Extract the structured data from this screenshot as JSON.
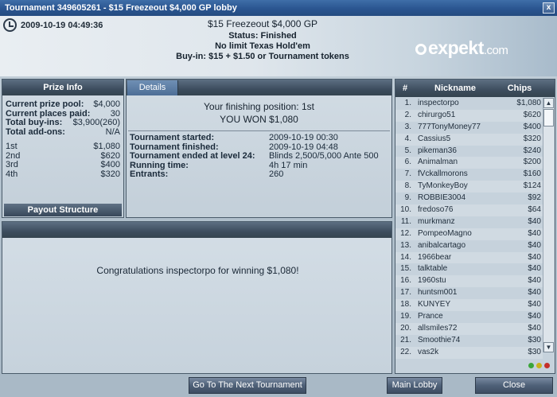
{
  "window": {
    "title": "Tournament 349605261 - $15 Freezeout $4,000 GP lobby",
    "close_label": "x"
  },
  "header": {
    "datetime": "2009-10-19 04:49:36",
    "name": "$15 Freezeout $4,000 GP",
    "status": "Status: Finished",
    "game": "No limit Texas Hold'em",
    "buyin": "Buy-in: $15 + $1.50 or Tournament tokens",
    "logo_text": "expekt",
    "logo_suffix": ".com"
  },
  "prize_info": {
    "title": "Prize Info",
    "rows": [
      {
        "k": "Current prize pool:",
        "v": "$4,000"
      },
      {
        "k": "Current places paid:",
        "v": "30"
      },
      {
        "k": "Total buy-ins:",
        "v": "$3,900(260)"
      },
      {
        "k": "Total add-ons:",
        "v": "N/A"
      }
    ],
    "places": [
      {
        "k": "1st",
        "v": "$1,080"
      },
      {
        "k": "2nd",
        "v": "$620"
      },
      {
        "k": "3rd",
        "v": "$400"
      },
      {
        "k": "4th",
        "v": "$320"
      }
    ],
    "payout_label": "Payout Structure"
  },
  "details": {
    "tab_label": "Details",
    "finishing": "Your finishing position:  1st",
    "won": "YOU WON $1,080",
    "rows": [
      {
        "k": "Tournament started:",
        "v": "2009-10-19 00:30"
      },
      {
        "k": "Tournament finished:",
        "v": "2009-10-19 04:48"
      },
      {
        "k": "Tournament ended at level 24:",
        "v": "Blinds 2,500/5,000 Ante 500"
      },
      {
        "k": "Running time:",
        "v": "4h 17 min"
      },
      {
        "k": "Entrants:",
        "v": "260"
      }
    ]
  },
  "message": {
    "text": "Congratulations inspectorpo for winning $1,080!"
  },
  "players": {
    "headers": {
      "num": "#",
      "nick": "Nickname",
      "chips": "Chips"
    },
    "rows": [
      {
        "n": "1.",
        "nick": "inspectorpo",
        "chips": "$1,080"
      },
      {
        "n": "2.",
        "nick": "chirurgo51",
        "chips": "$620"
      },
      {
        "n": "3.",
        "nick": "777TonyMoney77",
        "chips": "$400"
      },
      {
        "n": "4.",
        "nick": "Cassius5",
        "chips": "$320"
      },
      {
        "n": "5.",
        "nick": "pikeman36",
        "chips": "$240"
      },
      {
        "n": "6.",
        "nick": "Animalman",
        "chips": "$200"
      },
      {
        "n": "7.",
        "nick": "fVckallmorons",
        "chips": "$160"
      },
      {
        "n": "8.",
        "nick": "TyMonkeyBoy",
        "chips": "$124"
      },
      {
        "n": "9.",
        "nick": "ROBBIE3004",
        "chips": "$92"
      },
      {
        "n": "10.",
        "nick": "fredoso76",
        "chips": "$64"
      },
      {
        "n": "11.",
        "nick": "murkmanz",
        "chips": "$40"
      },
      {
        "n": "12.",
        "nick": "PompeoMagno",
        "chips": "$40"
      },
      {
        "n": "13.",
        "nick": "anibalcartago",
        "chips": "$40"
      },
      {
        "n": "14.",
        "nick": "1966bear",
        "chips": "$40"
      },
      {
        "n": "15.",
        "nick": "talktable",
        "chips": "$40"
      },
      {
        "n": "16.",
        "nick": "1960stu",
        "chips": "$40"
      },
      {
        "n": "17.",
        "nick": "huntsm001",
        "chips": "$40"
      },
      {
        "n": "18.",
        "nick": "KUNYEY",
        "chips": "$40"
      },
      {
        "n": "19.",
        "nick": "Prance",
        "chips": "$40"
      },
      {
        "n": "20.",
        "nick": "allsmiles72",
        "chips": "$40"
      },
      {
        "n": "21.",
        "nick": "Smoothie74",
        "chips": "$30"
      },
      {
        "n": "22.",
        "nick": "vas2k",
        "chips": "$30"
      }
    ],
    "status_dots": [
      "#3aa53a",
      "#c9b21e",
      "#c4302b"
    ]
  },
  "footer": {
    "next_label": "Go To The Next Tournament",
    "lobby_label": "Main Lobby",
    "close_label": "Close"
  }
}
